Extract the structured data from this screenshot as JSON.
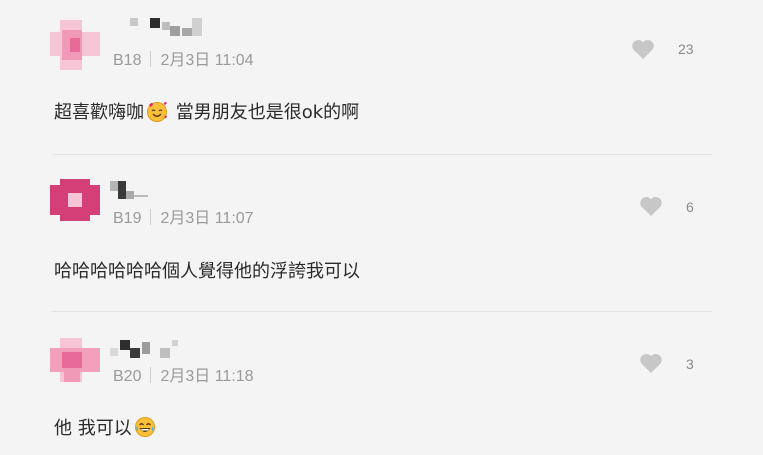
{
  "comments": [
    {
      "floor": "B18",
      "date": "2月3日 11:04",
      "likes": "23",
      "text_before": "超喜歡嗨咖",
      "text_after": " 當男朋友也是很ok的啊",
      "emoji": "smiling-face-with-hearts-icon"
    },
    {
      "floor": "B19",
      "date": "2月3日 11:07",
      "likes": "6",
      "text": "哈哈哈哈哈哈個人覺得他的浮誇我可以"
    },
    {
      "floor": "B20",
      "date": "2月3日 11:18",
      "likes": "3",
      "text_before": "他 我可以",
      "emoji": "laughing-face-icon"
    }
  ],
  "colors": {
    "avatar_pink": "#f3a0bd",
    "avatar_magenta": "#d43f78",
    "like_icon": "#c7c7c7"
  }
}
